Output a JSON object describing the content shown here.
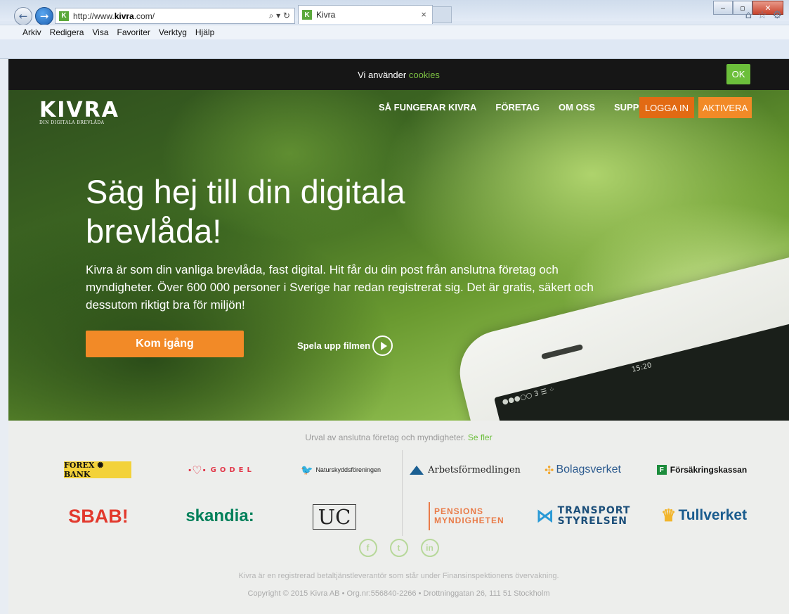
{
  "browser": {
    "url_prefix": "http://www.",
    "url_domain": "kivra",
    "url_suffix": ".com/",
    "address_tools": "⌕ ▾ ↻",
    "tab_title": "Kivra",
    "tab_close": "×",
    "favicon": "K",
    "toolbar_icons": [
      "⌂",
      "☆",
      "⚙"
    ],
    "window_buttons": [
      "‒",
      "▫",
      "✕"
    ],
    "menu": [
      "Arkiv",
      "Redigera",
      "Visa",
      "Favoriter",
      "Verktyg",
      "Hjälp"
    ]
  },
  "cookie_bar": {
    "text": "Vi använder ",
    "link": "cookies",
    "ok": "OK"
  },
  "header": {
    "logo": "KIVRA",
    "logo_sub": "DIN DIGITALA BREVLÅDA",
    "nav": [
      "SÅ FUNGERAR KIVRA",
      "FÖRETAG",
      "OM OSS",
      "SUPPORT"
    ],
    "login": "LOGGA IN",
    "activate": "AKTIVERA"
  },
  "hero": {
    "headline": "Säg hej till din digitala brevlåda!",
    "lead": "Kivra är som din vanliga brevlåda, fast digital. Hit får du din post från anslutna företag och myndigheter. Över 600 000 personer i Sverige har redan registrerat sig. Det är gratis, säkert och dessutom riktigt bra för miljön!",
    "cta": "Kom igång",
    "play_label": "Spela upp filmen",
    "phone_status": "●●●○○ 3 ☰ ⁘",
    "phone_time": "15:20"
  },
  "partners": {
    "intro": "Urval av anslutna företag och myndigheter. ",
    "intro_link": "Se fler",
    "row1": {
      "forex": "FOREX ✺ BANK",
      "godel_mark": "·♡·",
      "godel": "GODEL",
      "natur_mark": "🐦",
      "natur": "Naturskyddsföreningen",
      "arbets": "Arbetsförmedlingen",
      "bolag_mark": "✣",
      "bolag": "Bolagsverket",
      "forsak_mark": "F",
      "forsak": "Försäkringskassan"
    },
    "row2": {
      "sbab": "SBAB!",
      "skandia": "skandia:",
      "uc": "UC",
      "pension_1": "PENSIONS",
      "pension_2": "MYNDIGHETEN",
      "transport_mark": "⋈",
      "transport_1": "TRANSPORT",
      "transport_2": "STYRELSEN",
      "tull_mark": "♛",
      "tull": "Tullverket"
    }
  },
  "social": [
    "f",
    "t",
    "in"
  ],
  "footer": {
    "line1": "Kivra är en registrerad betaltjänstleverantör som står under Finansinspektionens övervakning.",
    "line2": "Copyright © 2015 Kivra AB • Org.nr:556840-2266 • Drottninggatan 26, 111 51 Stockholm"
  }
}
